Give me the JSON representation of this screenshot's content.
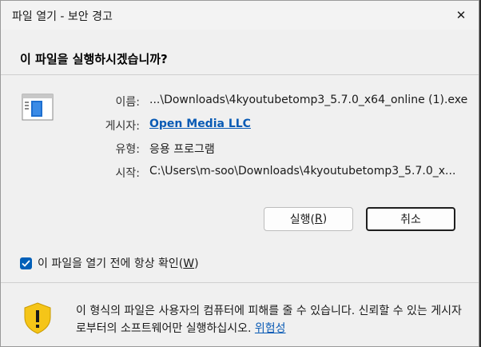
{
  "window": {
    "title": "파일 열기 - 보안 경고",
    "close_glyph": "✕"
  },
  "heading": "이 파일을 실행하시겠습니까?",
  "file": {
    "icon": "application-window-icon",
    "rows": [
      {
        "label": "이름:",
        "value": "...\\Downloads\\4kyoutubetomp3_5.7.0_x64_online (1).exe"
      },
      {
        "label": "게시자:",
        "value": "Open Media LLC"
      },
      {
        "label": "유형:",
        "value": "응용 프로그램"
      },
      {
        "label": "시작:",
        "value": "C:\\Users\\m-soo\\Downloads\\4kyoutubetomp3_5.7.0_x..."
      }
    ]
  },
  "buttons": {
    "run": {
      "label": "실행(",
      "accel": "R",
      "suffix": ")"
    },
    "cancel": {
      "label": "취소"
    }
  },
  "checkbox": {
    "checked": true,
    "label": "이 파일을 열기 전에 항상 확인(",
    "accel": "W",
    "suffix": ")"
  },
  "warning": {
    "icon": "shield-warning-icon",
    "text": "이 형식의 파일은 사용자의 컴퓨터에 피해를 줄 수 있습니다. 신뢰할 수 있는 게시자로부터의 소프트웨어만 실행하십시오. ",
    "link": "위험성"
  },
  "colors": {
    "accent": "#005fb8",
    "link": "#0a5bb5",
    "shield": "#f5c518"
  }
}
